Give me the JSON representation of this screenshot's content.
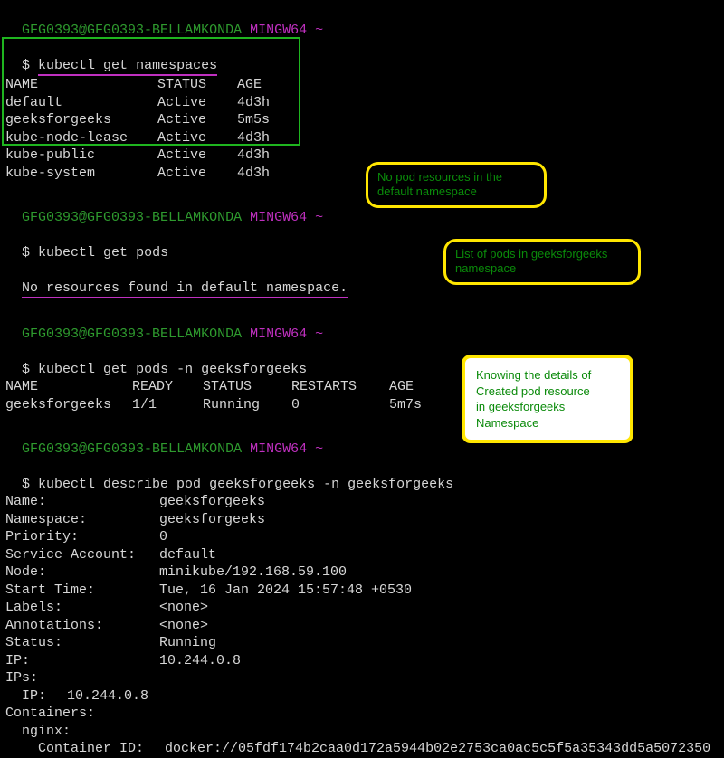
{
  "prompt": {
    "user": "GFG0393",
    "host": "GFG0393-BELLAMKONDA",
    "shell": "MINGW64",
    "tilde": "~",
    "dollar": "$"
  },
  "blocks": {
    "ns": {
      "cmd": "kubectl get namespaces",
      "header": {
        "c1": "NAME",
        "c2": "STATUS",
        "c3": "AGE"
      },
      "rows": [
        {
          "c1": "default",
          "c2": "Active",
          "c3": "4d3h"
        },
        {
          "c1": "geeksforgeeks",
          "c2": "Active",
          "c3": "5m5s"
        },
        {
          "c1": "kube-node-lease",
          "c2": "Active",
          "c3": "4d3h"
        },
        {
          "c1": "kube-public",
          "c2": "Active",
          "c3": "4d3h"
        },
        {
          "c1": "kube-system",
          "c2": "Active",
          "c3": "4d3h"
        }
      ]
    },
    "pods_default": {
      "cmd": "kubectl get pods",
      "msg": "No resources found in default namespace."
    },
    "pods_gfg": {
      "cmd": "kubectl get pods -n geeksforgeeks",
      "header": {
        "c1": "NAME",
        "c2": "READY",
        "c3": "STATUS",
        "c4": "RESTARTS",
        "c5": "AGE"
      },
      "row": {
        "c1": "geeksforgeeks",
        "c2": "1/1",
        "c3": "Running",
        "c4": "0",
        "c5": "5m7s"
      }
    },
    "describe": {
      "cmd": " kubectl describe pod geeksforgeeks -n geeksforgeeks",
      "fields": [
        {
          "k": "Name:",
          "v": "geeksforgeeks"
        },
        {
          "k": "Namespace:",
          "v": "geeksforgeeks"
        },
        {
          "k": "Priority:",
          "v": "0"
        },
        {
          "k": "Service Account:",
          "v": "default"
        },
        {
          "k": "Node:",
          "v": "minikube/192.168.59.100"
        },
        {
          "k": "Start Time:",
          "v": "Tue, 16 Jan 2024 15:57:48 +0530"
        },
        {
          "k": "Labels:",
          "v": "<none>"
        },
        {
          "k": "Annotations:",
          "v": "<none>"
        },
        {
          "k": "Status:",
          "v": "Running"
        },
        {
          "k": "IP:",
          "v": "10.244.0.8"
        }
      ],
      "ips_label": "IPs:",
      "ips_row": {
        "k": "IP:",
        "v": "10.244.0.8"
      },
      "containers_label": "Containers:",
      "container_name": "nginx:",
      "container_id": {
        "k": "Container ID:",
        "v": "docker://05fdf174b2caa0d172a5944b02e2753ca0ac5c5f5a35343dd5a5072350"
      }
    }
  },
  "callouts": {
    "no_pod": {
      "l1": "No pod resources in the",
      "l2": "default  namespace"
    },
    "list_pods": {
      "l1": "List of pods in geeksforgeeks",
      "l2": "namespace"
    },
    "details": {
      "l1": "Knowing the details of",
      "l2": "Created pod resource",
      "l3": "in geeksforgeeks",
      "l4": "Namespace"
    }
  }
}
